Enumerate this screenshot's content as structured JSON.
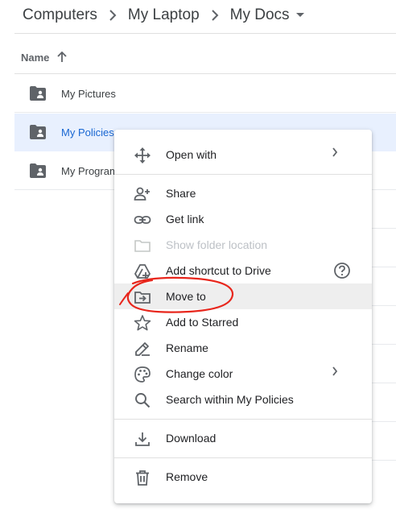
{
  "breadcrumb": {
    "items": [
      "Computers",
      "My Laptop",
      "My Docs"
    ]
  },
  "list": {
    "name_header": "Name",
    "rows": [
      {
        "name": "My Pictures"
      },
      {
        "name": "My Policies"
      },
      {
        "name": "My Programs"
      }
    ]
  },
  "context_menu": {
    "items": [
      {
        "label": "Open with",
        "icon": "open-with-icon",
        "submenu": true
      },
      {
        "label": "Share",
        "icon": "person-add-icon"
      },
      {
        "label": "Get link",
        "icon": "link-icon"
      },
      {
        "label": "Show folder location",
        "icon": "folder-icon",
        "disabled": true
      },
      {
        "label": "Add shortcut to Drive",
        "icon": "add-shortcut-icon",
        "help": true
      },
      {
        "label": "Move to",
        "icon": "move-to-icon",
        "highlighted": true
      },
      {
        "label": "Add to Starred",
        "icon": "star-icon"
      },
      {
        "label": "Rename",
        "icon": "pencil-icon"
      },
      {
        "label": "Change color",
        "icon": "palette-icon",
        "submenu": true
      },
      {
        "label": "Search within My Policies",
        "icon": "search-icon"
      },
      {
        "label": "Download",
        "icon": "download-icon"
      },
      {
        "label": "Remove",
        "icon": "trash-icon"
      }
    ]
  },
  "colors": {
    "selected_row_bg": "#e8f0fe",
    "selected_text": "#1967d2",
    "annotation_red": "#e8261c",
    "hover_bg": "#eeeeee"
  }
}
